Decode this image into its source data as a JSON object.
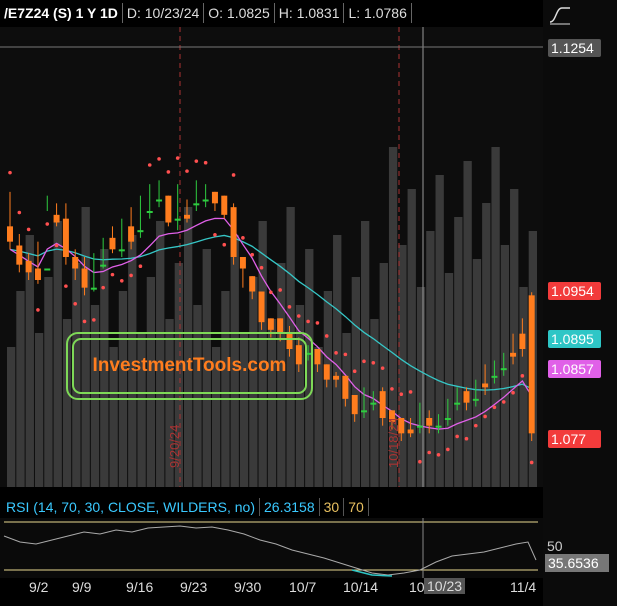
{
  "header": {
    "symbol": "/E7Z24 (S) 1 Y 1D",
    "date": "D: 10/23/24",
    "open": "O: 1.0825",
    "high": "H: 1.0831",
    "low": "L: 1.0786"
  },
  "price_labels": [
    {
      "text": "1.1254",
      "bg": "#555555",
      "fg": "#ffffff"
    },
    {
      "text": "1.0954",
      "bg": "#f23b3b",
      "fg": "#ffffff"
    },
    {
      "text": "1.0895",
      "bg": "#2ec6c6",
      "fg": "#ffffff"
    },
    {
      "text": "1.0857",
      "bg": "#e060e8",
      "fg": "#ffffff"
    },
    {
      "text": "1.077",
      "bg": "#f23b3b",
      "fg": "#ffffff"
    }
  ],
  "rsi": {
    "title": "RSI (14, 70, 30, CLOSE, WILDERS, no)",
    "value": "26.3158",
    "oversold": "30",
    "overbought": "70",
    "axis_50": "50",
    "current": "35.6536"
  },
  "x_axis": [
    "9/2",
    "9/9",
    "9/16",
    "9/23",
    "9/30",
    "10/7",
    "10/14",
    "10/23",
    "11/4"
  ],
  "crosshair_label": "10/23",
  "partial_label": "10",
  "vertical_markers": [
    "9/20/24",
    "10/18/24"
  ],
  "logo_text": "InvestmentTools.com",
  "colors": {
    "up": "#2ecc40",
    "down": "#ff7d1e",
    "sma": "#36c6c6",
    "ema": "#e060e8",
    "sar": "#ff5050"
  },
  "chart_data": {
    "type": "candlestick",
    "ylim": [
      1.07,
      1.13
    ],
    "candles": [
      [
        1.104,
        1.1085,
        1.102,
        1.101
      ],
      [
        1.1015,
        1.103,
        1.099,
        1.098
      ],
      [
        1.0995,
        1.1005,
        1.098,
        1.097
      ],
      [
        1.0985,
        1.102,
        1.097,
        1.0965
      ],
      [
        1.0985,
        1.106,
        1.0985,
        1.108
      ],
      [
        1.1055,
        1.107,
        1.1045,
        1.104
      ],
      [
        1.105,
        1.107,
        1.1,
        1.099
      ],
      [
        1.1,
        1.101,
        1.0985,
        1.097
      ],
      [
        1.0985,
        1.1,
        1.096,
        1.095
      ],
      [
        1.096,
        1.1005,
        1.096,
        1.0955
      ],
      [
        1.099,
        1.1025,
        1.099,
        1.0985
      ],
      [
        1.1025,
        1.104,
        1.101,
        1.1005
      ],
      [
        1.101,
        1.105,
        1.101,
        1.1
      ],
      [
        1.104,
        1.1065,
        1.102,
        1.101
      ],
      [
        1.1035,
        1.108,
        1.1035,
        1.1025
      ],
      [
        1.106,
        1.1095,
        1.106,
        1.105
      ],
      [
        1.1075,
        1.11,
        1.1075,
        1.1065
      ],
      [
        1.108,
        1.108,
        1.1045,
        1.104
      ],
      [
        1.105,
        1.1095,
        1.105,
        1.1035
      ],
      [
        1.1055,
        1.1075,
        1.105,
        1.1045
      ],
      [
        1.107,
        1.11,
        1.107,
        1.106
      ],
      [
        1.1075,
        1.1095,
        1.1075,
        1.1065
      ],
      [
        1.1085,
        1.1085,
        1.107,
        1.106
      ],
      [
        1.108,
        1.108,
        1.1055,
        1.105
      ],
      [
        1.1065,
        1.107,
        1.1,
        1.099
      ],
      [
        1.1,
        1.1,
        1.0985,
        1.096
      ],
      [
        1.0975,
        1.0975,
        1.0955,
        1.0945
      ],
      [
        1.0955,
        1.0955,
        1.0915,
        1.0905
      ],
      [
        1.092,
        1.092,
        1.0905,
        1.0895
      ],
      [
        1.092,
        1.092,
        1.09,
        1.089
      ],
      [
        1.09,
        1.091,
        1.088,
        1.087
      ],
      [
        1.0885,
        1.0895,
        1.086,
        1.085
      ],
      [
        1.0875,
        1.0885,
        1.0875,
        1.0865
      ],
      [
        1.088,
        1.088,
        1.086,
        1.085
      ],
      [
        1.086,
        1.086,
        1.084,
        1.083
      ],
      [
        1.0845,
        1.085,
        1.084,
        1.083
      ],
      [
        1.0845,
        1.0845,
        1.0815,
        1.0805
      ],
      [
        1.082,
        1.082,
        1.0795,
        1.0785
      ],
      [
        1.08,
        1.083,
        1.08,
        1.079
      ],
      [
        1.081,
        1.0825,
        1.081,
        1.08
      ],
      [
        1.0825,
        1.083,
        1.079,
        1.078
      ],
      [
        1.08,
        1.08,
        1.0785,
        1.0775
      ],
      [
        1.079,
        1.079,
        1.077,
        1.076
      ],
      [
        1.0775,
        1.079,
        1.077,
        1.0765
      ],
      [
        1.078,
        1.081,
        1.078,
        1.077
      ],
      [
        1.079,
        1.08,
        1.078,
        1.077
      ],
      [
        1.078,
        1.0795,
        1.078,
        1.077
      ],
      [
        1.079,
        1.0815,
        1.079,
        1.078
      ],
      [
        1.081,
        1.083,
        1.081,
        1.08
      ],
      [
        1.0825,
        1.083,
        1.081,
        1.08
      ],
      [
        1.0815,
        1.084,
        1.0815,
        1.0805
      ],
      [
        1.0835,
        1.086,
        1.083,
        1.082
      ],
      [
        1.0845,
        1.0865,
        1.0845,
        1.0835
      ],
      [
        1.0855,
        1.0875,
        1.0855,
        1.0845
      ],
      [
        1.0875,
        1.09,
        1.087,
        1.086
      ],
      [
        1.09,
        1.092,
        1.088,
        1.087
      ],
      [
        1.095,
        1.0954,
        1.077,
        1.076
      ]
    ]
  }
}
